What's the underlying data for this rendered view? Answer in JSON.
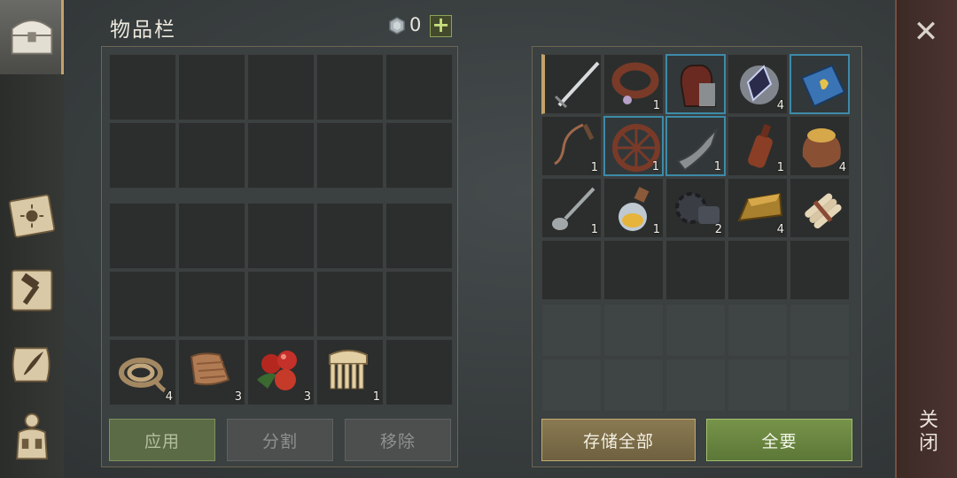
{
  "inventory": {
    "title": "物品栏",
    "currency": "0",
    "plus": "+",
    "stash_items": [
      {
        "icon": "rope-icon",
        "qty": "4"
      },
      {
        "icon": "cloth-icon",
        "qty": "3"
      },
      {
        "icon": "berries-icon",
        "qty": "3"
      },
      {
        "icon": "comb-icon",
        "qty": "1"
      }
    ],
    "buttons": {
      "apply": "应用",
      "split": "分割",
      "remove": "移除"
    }
  },
  "storage": {
    "items": [
      {
        "icon": "sword-icon",
        "qty": ""
      },
      {
        "icon": "collar-icon",
        "qty": "1"
      },
      {
        "icon": "gauntlet-icon",
        "qty": ""
      },
      {
        "icon": "crystal-icon",
        "qty": "4"
      },
      {
        "icon": "book-icon",
        "qty": ""
      },
      {
        "icon": "whip-icon",
        "qty": "1"
      },
      {
        "icon": "wheel-icon",
        "qty": "1"
      },
      {
        "icon": "blade-fragment-icon",
        "qty": "1"
      },
      {
        "icon": "bottle-icon",
        "qty": "1"
      },
      {
        "icon": "grain-sack-icon",
        "qty": "4"
      },
      {
        "icon": "spoon-icon",
        "qty": "1"
      },
      {
        "icon": "potion-icon",
        "qty": "1"
      },
      {
        "icon": "gear-part-icon",
        "qty": "2"
      },
      {
        "icon": "ingot-icon",
        "qty": "4"
      },
      {
        "icon": "scroll-bundle-icon",
        "qty": ""
      }
    ],
    "buttons": {
      "store_all": "存储全部",
      "take_all": "全要"
    }
  },
  "close": {
    "label": "关闭",
    "x": "✕"
  }
}
